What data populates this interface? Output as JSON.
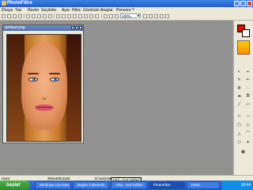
{
  "window": {
    "title": "PhotoFiltre"
  },
  "menu": [
    "Dosya",
    "Yaz",
    "Resim",
    "Seçimler",
    "Ayar",
    "Filtre",
    "Görünüm",
    "Araçlar",
    "Pencere",
    "?"
  ],
  "toolbar": {
    "zoom_value": "100%"
  },
  "document": {
    "title": "avrilavr.png"
  },
  "status": {
    "left": "Hazır",
    "size": "300x400x16M",
    "file": "D:\\resimler\\Avril",
    "tooltip": "Arka - Not Defteri"
  },
  "taskbar": {
    "start_label": "başlat",
    "tasks": [
      "Windows Live Mes...",
      "Bugün 4 Benimki...",
      "Arka - Not Defteri",
      "PhotoFiltre",
      "Paint..."
    ],
    "clock": "18:44"
  },
  "colors": {
    "foreground": "#e80000",
    "background": "#ffffff",
    "taskbar": "#245ccc"
  }
}
